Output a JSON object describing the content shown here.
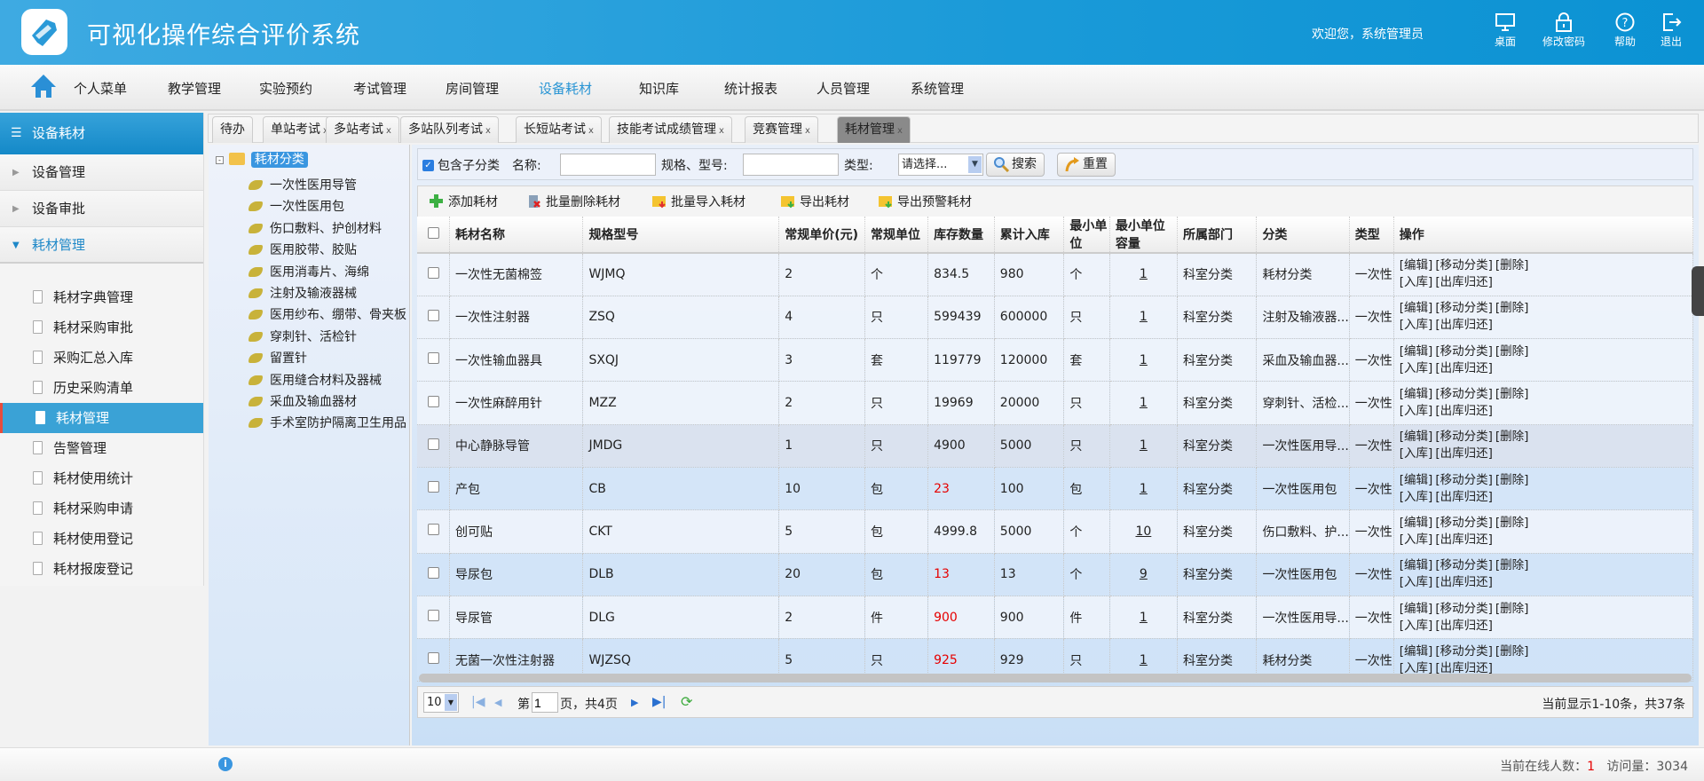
{
  "header": {
    "title": "可视化操作综合评价系统",
    "welcome": "欢迎您，系统管理员",
    "buttons": [
      {
        "label": "桌面",
        "icon": "desktop-icon"
      },
      {
        "label": "修改密码",
        "icon": "lock-icon"
      },
      {
        "label": "帮助",
        "icon": "help-icon"
      },
      {
        "label": "退出",
        "icon": "logout-icon"
      }
    ]
  },
  "nav": {
    "items": [
      "个人菜单",
      "教学管理",
      "实验预约",
      "考试管理",
      "房间管理",
      "设备耗材",
      "知识库",
      "统计报表",
      "人员管理",
      "系统管理"
    ],
    "active": "设备耗材"
  },
  "sidebar": {
    "title": "设备耗材",
    "groups": [
      "设备管理",
      "设备审批",
      "耗材管理"
    ],
    "items": [
      "耗材字典管理",
      "耗材采购审批",
      "采购汇总入库",
      "历史采购清单",
      "耗材管理",
      "告警管理",
      "耗材使用统计",
      "耗材采购申请",
      "耗材使用登记",
      "耗材报废登记"
    ],
    "active": "耗材管理"
  },
  "tabs": [
    {
      "label": "待办",
      "closable": false
    },
    {
      "label": "单站考试",
      "closable": true
    },
    {
      "label": "多站考试",
      "closable": true
    },
    {
      "label": "多站队列考试",
      "closable": true
    },
    {
      "label": "长短站考试",
      "closable": true
    },
    {
      "label": "技能考试成绩管理",
      "closable": true
    },
    {
      "label": "竞赛管理",
      "closable": true
    },
    {
      "label": "耗材管理",
      "closable": true,
      "active": true
    }
  ],
  "tabs_close": "x",
  "tree": {
    "root": "耗材分类",
    "children": [
      "一次性医用导管",
      "一次性医用包",
      "伤口敷料、护创材料",
      "医用胶带、胶贴",
      "医用消毒片、海绵",
      "注射及输液器械",
      "医用纱布、绷带、骨夹板",
      "穿刺针、活检针",
      "留置针",
      "医用缝合材料及器械",
      "采血及输血器材",
      "手术室防护隔离卫生用品"
    ]
  },
  "search": {
    "include_sub": "包含子分类",
    "include_sub_checked": true,
    "name_label": "名称:",
    "name_value": "",
    "spec_label": "规格、型号:",
    "spec_value": "",
    "type_label": "类型:",
    "type_value": "请选择...",
    "search_btn": "搜索",
    "reset_btn": "重置"
  },
  "toolbar": {
    "add": "添加耗材",
    "batch_delete": "批量删除耗材",
    "batch_import": "批量导入耗材",
    "export": "导出耗材",
    "export_warning": "导出预警耗材"
  },
  "table": {
    "columns": [
      "耗材名称",
      "规格型号",
      "常规单价(元)",
      "常规单位",
      "库存数量",
      "累计入库",
      "最小单位",
      "最小单位容量",
      "所属部门",
      "分类",
      "类型",
      "操作"
    ],
    "ops": [
      "[编辑]",
      "[移动分类]",
      "[删除]",
      "[入库]",
      "[出库归还]"
    ],
    "rows": [
      {
        "name": "一次性无菌棉签",
        "spec": "WJMQ",
        "price": "2",
        "unit": "个",
        "stock": "834.5",
        "stock_warning": false,
        "total": "980",
        "min_unit": "个",
        "capacity": "1",
        "dept": "科室分类",
        "category": "耗材分类",
        "type": "一次性"
      },
      {
        "name": "一次性注射器",
        "spec": "ZSQ",
        "price": "4",
        "unit": "只",
        "stock": "599439",
        "stock_warning": false,
        "total": "600000",
        "min_unit": "只",
        "capacity": "1",
        "dept": "科室分类",
        "category": "注射及输液器...",
        "type": "一次性"
      },
      {
        "name": "一次性输血器具",
        "spec": "SXQJ",
        "price": "3",
        "unit": "套",
        "stock": "119779",
        "stock_warning": false,
        "total": "120000",
        "min_unit": "套",
        "capacity": "1",
        "dept": "科室分类",
        "category": "采血及输血器...",
        "type": "一次性"
      },
      {
        "name": "一次性麻醉用针",
        "spec": "MZZ",
        "price": "2",
        "unit": "只",
        "stock": "19969",
        "stock_warning": false,
        "total": "20000",
        "min_unit": "只",
        "capacity": "1",
        "dept": "科室分类",
        "category": "穿刺针、活检...",
        "type": "一次性"
      },
      {
        "name": "中心静脉导管",
        "spec": "JMDG",
        "price": "1",
        "unit": "只",
        "stock": "4900",
        "stock_warning": false,
        "total": "5000",
        "min_unit": "只",
        "capacity": "1",
        "dept": "科室分类",
        "category": "一次性医用导...",
        "type": "一次性",
        "highlighted": true
      },
      {
        "name": "产包",
        "spec": "CB",
        "price": "10",
        "unit": "包",
        "stock": "23",
        "stock_warning": true,
        "total": "100",
        "min_unit": "包",
        "capacity": "1",
        "dept": "科室分类",
        "category": "一次性医用包",
        "type": "一次性"
      },
      {
        "name": "创可贴",
        "spec": "CKT",
        "price": "5",
        "unit": "包",
        "stock": "4999.8",
        "stock_warning": false,
        "total": "5000",
        "min_unit": "个",
        "capacity": "10",
        "dept": "科室分类",
        "category": "伤口敷料、护...",
        "type": "一次性"
      },
      {
        "name": "导尿包",
        "spec": "DLB",
        "price": "20",
        "unit": "包",
        "stock": "13",
        "stock_warning": true,
        "total": "13",
        "min_unit": "个",
        "capacity": "9",
        "dept": "科室分类",
        "category": "一次性医用包",
        "type": "一次性"
      },
      {
        "name": "导尿管",
        "spec": "DLG",
        "price": "2",
        "unit": "件",
        "stock": "900",
        "stock_warning": true,
        "total": "900",
        "min_unit": "件",
        "capacity": "1",
        "dept": "科室分类",
        "category": "一次性医用导...",
        "type": "一次性"
      },
      {
        "name": "无菌一次性注射器",
        "spec": "WJZSQ",
        "price": "5",
        "unit": "只",
        "stock": "925",
        "stock_warning": true,
        "total": "929",
        "min_unit": "只",
        "capacity": "1",
        "dept": "科室分类",
        "category": "耗材分类",
        "type": "一次性"
      }
    ]
  },
  "pager": {
    "page_size": "10",
    "page_prefix": "第",
    "page_value": "1",
    "page_suffix": "页，共4页",
    "summary": "当前显示1-10条，共37条"
  },
  "status": {
    "online_label": "当前在线人数：",
    "online_value": "1",
    "visits_label": "访问量：",
    "visits_value": "3034"
  },
  "colors": {
    "accent": "#2a95d4",
    "header": "#1a9ad8",
    "warning": "#e60000",
    "selected": "#3aa2d6"
  }
}
